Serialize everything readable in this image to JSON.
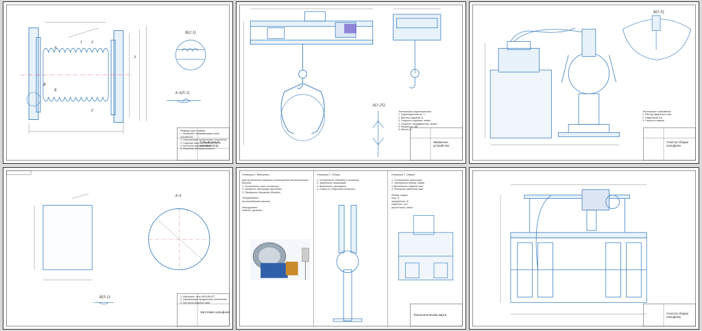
{
  "sheets": [
    {
      "id": "bellows",
      "section_label": "Б(2:1)",
      "section_aa": "А-А(5:1)",
      "labels": [
        "А",
        "Б",
        "В",
        "Г",
        "1",
        "2",
        "3"
      ],
      "title_block": "Сильфонный компенсатор",
      "notes": "Размеры для справок.\n1. Материал: нержавеющая сталь 12Х18Н10Т\n2. Неуказанные предельные отклонения\n3. Сварные швы по ГОСТ 14771-76\n4. Контроль сварных швов\n5. Испытать на герметичность"
    },
    {
      "id": "crane",
      "section_label": "А(1:25)",
      "title_block": "Захватное устройство",
      "notes": "Техническая характеристика\n1. Грузоподъемность, т\n2. Высота подъема, м\n3. Скорость подъема, м/мин\n4. Скорость передвижения, м/мин\n5. Мощность, кВт\n6. Масса, кг"
    },
    {
      "id": "welding-station",
      "section_label": "Б(1:5)",
      "title_block": "Участок сборки сильфона",
      "notes": "Технические требования\n1. Расход защитного газа\n2. Сварочный ток\n3. Скорость сварки"
    },
    {
      "id": "blank",
      "section_label": "А-А",
      "corner": "Б(5:1)",
      "title_block": "Заготовка сильфона",
      "notes": "1. Материал: лист 08Х18Н10Т\n2. Неуказанные предельные отклонения\n3. Контроль сварного шва"
    },
    {
      "id": "process",
      "title_block": "Технологическая карта",
      "col1_heading": "Операция 1. Вальцовка",
      "col1": "Для выполнения операции используется листогибочная машина.\n1. Установить лист на вальцы\n2. Провести вальцовку заготовки\n3. Проверить диаметр обечайки\n\nОборудование:\nлистогибочная машина\n\nИнструмент:\nшаблон, рулетка",
      "col2_heading": "Операция 2. Сборка",
      "col2": "1. Установить обечайку в оснастку\n2. Закрепить прижимами\n3. Выполнить прихватки\n4. Снять со сборочной оснастки",
      "col3_heading": "Операция 3. Сварка",
      "col3": "1. Установить заготовку\n2. Настроить режим сварки\n3. Выполнить сварной шов\n4. Контроль качества шва\n\nРежим сварки:\nток, А\nнапряжение, В\nскорость, м/ч\nрасход газа, л/мин"
    },
    {
      "id": "frame",
      "title_block": "Участок сборки сильфона",
      "notes": ""
    }
  ]
}
